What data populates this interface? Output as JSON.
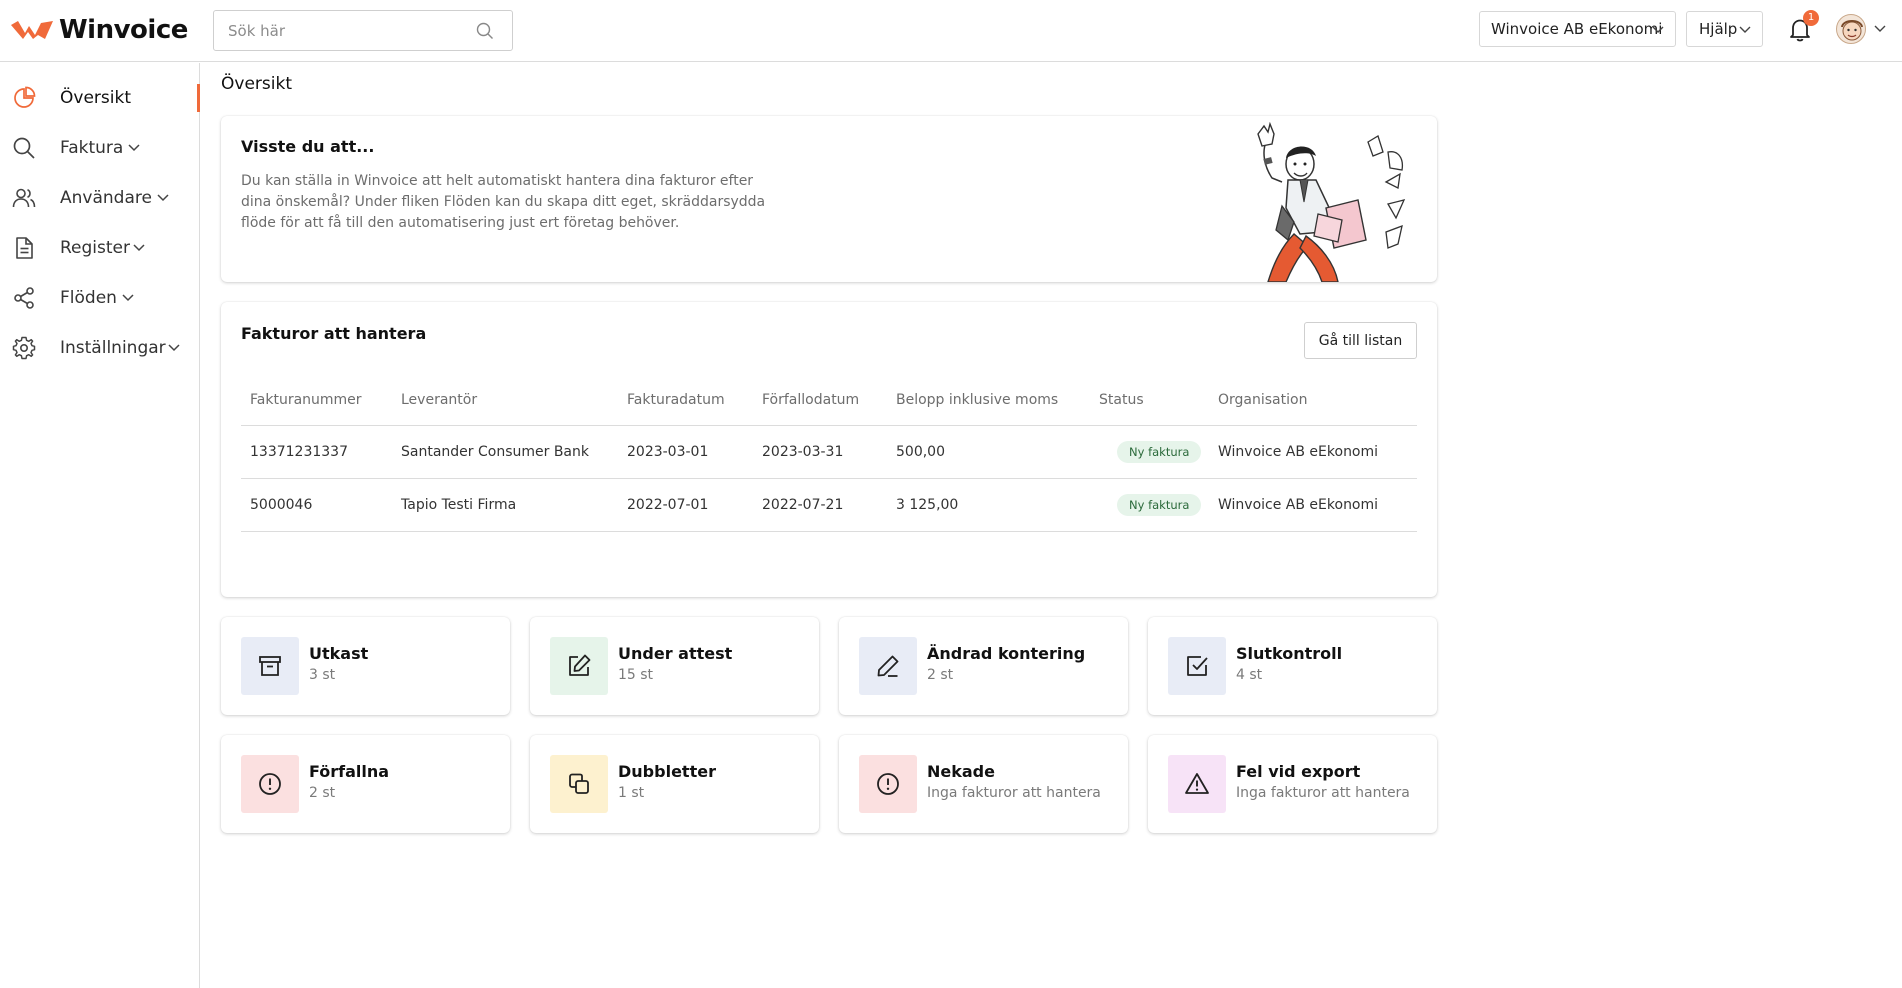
{
  "app": {
    "logo_text": "Winvoice",
    "brand_color": "#f06a3a"
  },
  "header": {
    "search_placeholder": "Sök här",
    "org_select": "Winvoice AB eEkonomi",
    "help_select": "Hjälp",
    "notification_count": "1"
  },
  "sidebar": {
    "items": [
      {
        "label": "Översikt",
        "icon": "pie-chart-icon"
      },
      {
        "label": "Faktura",
        "icon": "search-icon"
      },
      {
        "label": "Användare",
        "icon": "users-icon"
      },
      {
        "label": "Register",
        "icon": "document-icon"
      },
      {
        "label": "Flöden",
        "icon": "share-icon"
      },
      {
        "label": "Inställningar",
        "icon": "gear-icon"
      }
    ]
  },
  "main": {
    "page_title": "Översikt",
    "tip": {
      "title": "Visste du att...",
      "text": "Du kan ställa in Winvoice att helt automatiskt hantera dina fakturor efter dina önskemål? Under fliken Flöden kan du skapa ditt eget, skräddarsydda flöde för att få till den automatisering just ert företag behöver."
    },
    "invoices": {
      "title": "Fakturor att hantera",
      "goto_button": "Gå till listan",
      "columns": [
        "Fakturanummer",
        "Leverantör",
        "Fakturadatum",
        "Förfallodatum",
        "Belopp inklusive moms",
        "Status",
        "Organisation"
      ],
      "rows": [
        [
          "13371231337",
          "Santander Consumer Bank",
          "2023-03-01",
          "2023-03-31",
          "500,00",
          "Ny faktura",
          "Winvoice AB eEkonomi"
        ],
        [
          "5000046",
          "Tapio Testi Firma",
          "2022-07-01",
          "2022-07-21",
          "3 125,00",
          "Ny faktura",
          "Winvoice AB eEkonomi"
        ]
      ]
    },
    "tiles": [
      {
        "title": "Utkast",
        "sub": "3 st",
        "icon": "archive-icon",
        "bg": "#e8ecf6"
      },
      {
        "title": "Under attest",
        "sub": "15 st",
        "icon": "edit-square-icon",
        "bg": "#e6f4ea"
      },
      {
        "title": "Ändrad kontering",
        "sub": "2 st",
        "icon": "pencil-icon",
        "bg": "#e8ecf6"
      },
      {
        "title": "Slutkontroll",
        "sub": "4 st",
        "icon": "check-square-icon",
        "bg": "#e8ecf6"
      },
      {
        "title": "Förfallna",
        "sub": "2 st",
        "icon": "alert-circle-icon",
        "bg": "#fbe0e0"
      },
      {
        "title": "Dubbletter",
        "sub": "1 st",
        "icon": "copy-icon",
        "bg": "#fdf1cf"
      },
      {
        "title": "Nekade",
        "sub": "Inga fakturor att hantera",
        "icon": "alert-circle-icon",
        "bg": "#fbe0e0"
      },
      {
        "title": "Fel vid export",
        "sub": "Inga fakturor att hantera",
        "icon": "warning-triangle-icon",
        "bg": "#f7e3f7"
      }
    ]
  }
}
